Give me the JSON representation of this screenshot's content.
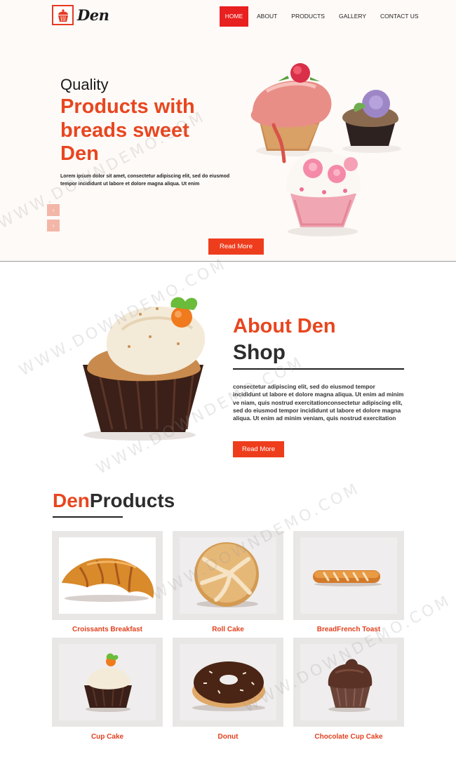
{
  "header": {
    "logo_text": "Den",
    "nav": [
      {
        "label": "HOME",
        "active": true
      },
      {
        "label": "ABOUT",
        "active": false
      },
      {
        "label": "PRODUCTS",
        "active": false
      },
      {
        "label": "GALLERY",
        "active": false
      },
      {
        "label": "CONTACT US",
        "active": false
      }
    ]
  },
  "hero": {
    "small_title": "Quality",
    "big_title": "Products with breads sweet Den",
    "paragraph": "Lorem ipsum dolor sit amet, consectetur adipiscing elit, sed do eiusmod tempor incididunt ut labore et dolore magna aliqua. Ut enim",
    "read_more": "Read More",
    "slider_icons": [
      "chevron-up-icon",
      "chevron-down-icon"
    ]
  },
  "about": {
    "title_line1": "About Den",
    "title_line2": "Shop",
    "paragraph": "consectetur adipiscing elit, sed do eiusmod tempor incididunt ut labore et dolore magna aliqua. Ut enim ad minim ve niam, quis nostrud exercitationconsectetur adipiscing elit, sed do eiusmod tempor incididunt ut labore et dolore magna aliqua. Ut enim ad minim veniam, quis nostrud exercitation",
    "read_more": "Read More"
  },
  "products": {
    "heading_accent": "Den",
    "heading_rest": "Products",
    "items": [
      {
        "label": "Croissants Breakfast",
        "icon": "croissant-icon"
      },
      {
        "label": "Roll Cake",
        "icon": "bread-roll-icon"
      },
      {
        "label": "BreadFrench Toast",
        "icon": "baguette-icon"
      },
      {
        "label": "Cup Cake",
        "icon": "cupcake-icon"
      },
      {
        "label": "Donut",
        "icon": "donut-icon"
      },
      {
        "label": "Chocolate Cup Cake",
        "icon": "chocolate-cupcake-icon"
      }
    ]
  },
  "colors": {
    "accent": "#e8461f",
    "nav_active": "#e8201f",
    "button": "#ee3d1d",
    "dark_text": "#2d2d2d",
    "card_bg": "#e9e6e6"
  },
  "watermark": "WWW.DOWNDEMO.COM"
}
